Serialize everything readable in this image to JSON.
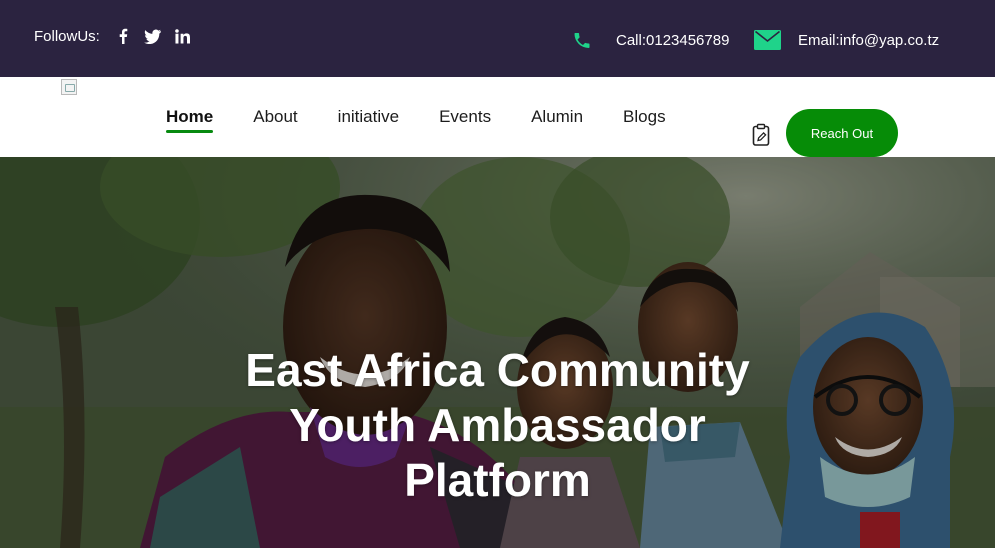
{
  "topbar": {
    "follow_label": "FollowUs:",
    "social": [
      "facebook-icon",
      "twitter-icon",
      "linkedin-icon"
    ],
    "call_text": "Call:0123456789",
    "email_text": "Email:info@yap.co.tz"
  },
  "nav": {
    "items": [
      {
        "label": "Home",
        "active": true
      },
      {
        "label": "About"
      },
      {
        "label": "initiative"
      },
      {
        "label": "Events"
      },
      {
        "label": "Alumin"
      },
      {
        "label": "Blogs"
      }
    ],
    "cta_label": "Reach Out"
  },
  "hero": {
    "title_lines": [
      "East Africa Community",
      "Youth Ambassador",
      "Platform"
    ]
  },
  "colors": {
    "topbar_bg": "#2b2340",
    "contact_icon": "#1fd38a",
    "accent_green": "#068c07",
    "active_underline": "#078a10"
  }
}
